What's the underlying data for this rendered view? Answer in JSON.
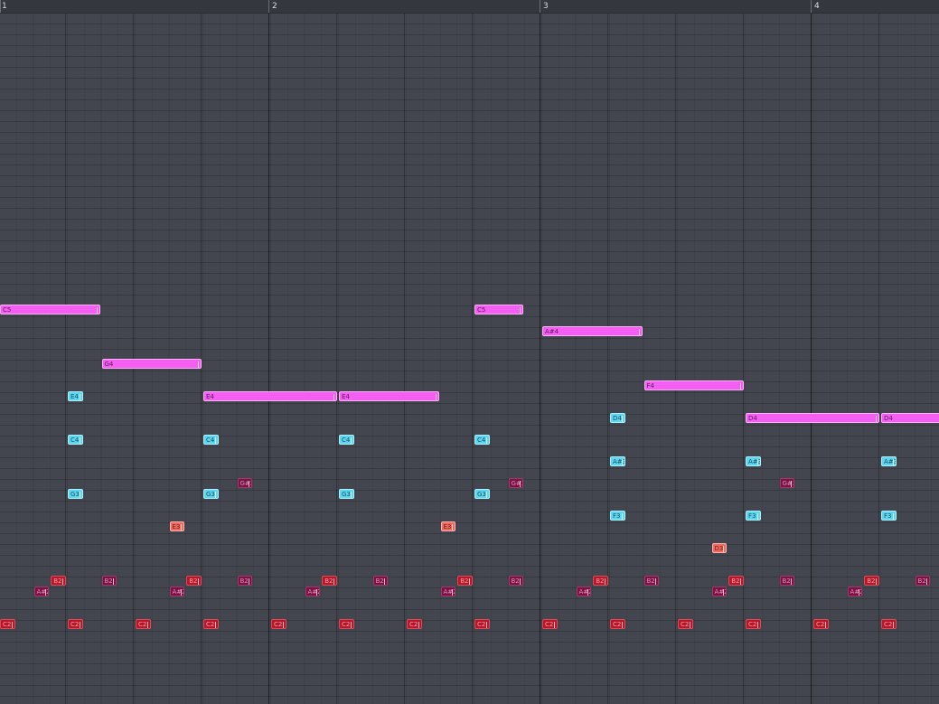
{
  "ruler": {
    "bars": [
      "1",
      "2",
      "3",
      "4"
    ]
  },
  "notes": [
    {
      "pitch": "C5",
      "color": "pink",
      "start": 0,
      "len": 1.5
    },
    {
      "pitch": "G4",
      "color": "pink",
      "start": 1.5,
      "len": 1.5
    },
    {
      "pitch": "E4",
      "color": "pink",
      "start": 3,
      "len": 2
    },
    {
      "pitch": "E4",
      "color": "pink",
      "start": 5,
      "len": 1.5
    },
    {
      "pitch": "C5",
      "color": "pink",
      "start": 7,
      "len": 0.75
    },
    {
      "pitch": "A#4",
      "color": "pink",
      "start": 8,
      "len": 1.5
    },
    {
      "pitch": "F4",
      "color": "pink",
      "start": 9.5,
      "len": 1.5
    },
    {
      "pitch": "D4",
      "color": "pink",
      "start": 11,
      "len": 2
    },
    {
      "pitch": "D4",
      "color": "pink",
      "start": 13,
      "len": 1
    },
    {
      "pitch": "E4",
      "color": "cyan",
      "start": 1,
      "len": 0.25
    },
    {
      "pitch": "C4",
      "color": "cyan",
      "start": 1,
      "len": 0.25
    },
    {
      "pitch": "G3",
      "color": "cyan",
      "start": 1,
      "len": 0.25
    },
    {
      "pitch": "C4",
      "color": "cyan",
      "start": 3,
      "len": 0.25
    },
    {
      "pitch": "G3",
      "color": "cyan",
      "start": 3,
      "len": 0.25
    },
    {
      "pitch": "C4",
      "color": "cyan",
      "start": 5,
      "len": 0.25
    },
    {
      "pitch": "G3",
      "color": "cyan",
      "start": 5,
      "len": 0.25
    },
    {
      "pitch": "C4",
      "color": "cyan",
      "start": 7,
      "len": 0.25
    },
    {
      "pitch": "G3",
      "color": "cyan",
      "start": 7,
      "len": 0.25
    },
    {
      "pitch": "D4",
      "color": "cyan",
      "start": 9,
      "len": 0.25
    },
    {
      "pitch": "A#3",
      "color": "cyan",
      "start": 9,
      "len": 0.25
    },
    {
      "pitch": "F3",
      "color": "cyan",
      "start": 9,
      "len": 0.25
    },
    {
      "pitch": "A#3",
      "color": "cyan",
      "start": 11,
      "len": 0.25
    },
    {
      "pitch": "F3",
      "color": "cyan",
      "start": 11,
      "len": 0.25
    },
    {
      "pitch": "A#3",
      "color": "cyan",
      "start": 13,
      "len": 0.25
    },
    {
      "pitch": "F3",
      "color": "cyan",
      "start": 13,
      "len": 0.25
    },
    {
      "pitch": "E3",
      "color": "salmon",
      "start": 2.5,
      "len": 0.25
    },
    {
      "pitch": "E3",
      "color": "salmon",
      "start": 6.5,
      "len": 0.25
    },
    {
      "pitch": "D3",
      "color": "salmon",
      "start": 10.5,
      "len": 0.25
    },
    {
      "pitch": "G#3",
      "color": "maroon",
      "start": 3.5,
      "len": 0.25
    },
    {
      "pitch": "G#3",
      "color": "maroon",
      "start": 7.5,
      "len": 0.25
    },
    {
      "pitch": "G#3",
      "color": "maroon",
      "start": 11.5,
      "len": 0.25
    },
    {
      "pitch": "C2",
      "color": "dred",
      "start": 0,
      "len": 0.25
    },
    {
      "pitch": "C2",
      "color": "dred",
      "start": 1,
      "len": 0.25
    },
    {
      "pitch": "C2",
      "color": "dred",
      "start": 2,
      "len": 0.25
    },
    {
      "pitch": "C2",
      "color": "dred",
      "start": 3,
      "len": 0.25
    },
    {
      "pitch": "C2",
      "color": "dred",
      "start": 4,
      "len": 0.25
    },
    {
      "pitch": "C2",
      "color": "dred",
      "start": 5,
      "len": 0.25
    },
    {
      "pitch": "C2",
      "color": "dred",
      "start": 6,
      "len": 0.25
    },
    {
      "pitch": "C2",
      "color": "dred",
      "start": 7,
      "len": 0.25
    },
    {
      "pitch": "C2",
      "color": "dred",
      "start": 8,
      "len": 0.25
    },
    {
      "pitch": "C2",
      "color": "dred",
      "start": 9,
      "len": 0.25
    },
    {
      "pitch": "C2",
      "color": "dred",
      "start": 10,
      "len": 0.25
    },
    {
      "pitch": "C2",
      "color": "dred",
      "start": 11,
      "len": 0.25
    },
    {
      "pitch": "C2",
      "color": "dred",
      "start": 12,
      "len": 0.25
    },
    {
      "pitch": "C2",
      "color": "dred",
      "start": 13,
      "len": 0.25
    },
    {
      "pitch": "B2",
      "color": "dred",
      "start": 0.75,
      "len": 0.25
    },
    {
      "pitch": "B2",
      "color": "maroon",
      "start": 1.5,
      "len": 0.25
    },
    {
      "pitch": "B2",
      "color": "dred",
      "start": 2.75,
      "len": 0.25
    },
    {
      "pitch": "B2",
      "color": "maroon",
      "start": 3.5,
      "len": 0.25
    },
    {
      "pitch": "B2",
      "color": "dred",
      "start": 4.75,
      "len": 0.25
    },
    {
      "pitch": "B2",
      "color": "maroon",
      "start": 5.5,
      "len": 0.25
    },
    {
      "pitch": "B2",
      "color": "dred",
      "start": 6.75,
      "len": 0.25
    },
    {
      "pitch": "B2",
      "color": "maroon",
      "start": 7.5,
      "len": 0.25
    },
    {
      "pitch": "B2",
      "color": "dred",
      "start": 8.75,
      "len": 0.25
    },
    {
      "pitch": "B2",
      "color": "maroon",
      "start": 9.5,
      "len": 0.25
    },
    {
      "pitch": "B2",
      "color": "dred",
      "start": 10.75,
      "len": 0.25
    },
    {
      "pitch": "B2",
      "color": "maroon",
      "start": 11.5,
      "len": 0.25
    },
    {
      "pitch": "B2",
      "color": "dred",
      "start": 12.75,
      "len": 0.25
    },
    {
      "pitch": "B2",
      "color": "maroon",
      "start": 13.5,
      "len": 0.25
    },
    {
      "pitch": "A#2",
      "color": "maroon",
      "start": 0.5,
      "len": 0.25
    },
    {
      "pitch": "A#2",
      "color": "maroon",
      "start": 2.5,
      "len": 0.25
    },
    {
      "pitch": "A#2",
      "color": "maroon",
      "start": 4.5,
      "len": 0.25
    },
    {
      "pitch": "A#2",
      "color": "maroon",
      "start": 6.5,
      "len": 0.25
    },
    {
      "pitch": "A#2",
      "color": "maroon",
      "start": 8.5,
      "len": 0.25
    },
    {
      "pitch": "A#2",
      "color": "maroon",
      "start": 10.5,
      "len": 0.25
    },
    {
      "pitch": "A#2",
      "color": "maroon",
      "start": 12.5,
      "len": 0.25
    }
  ]
}
